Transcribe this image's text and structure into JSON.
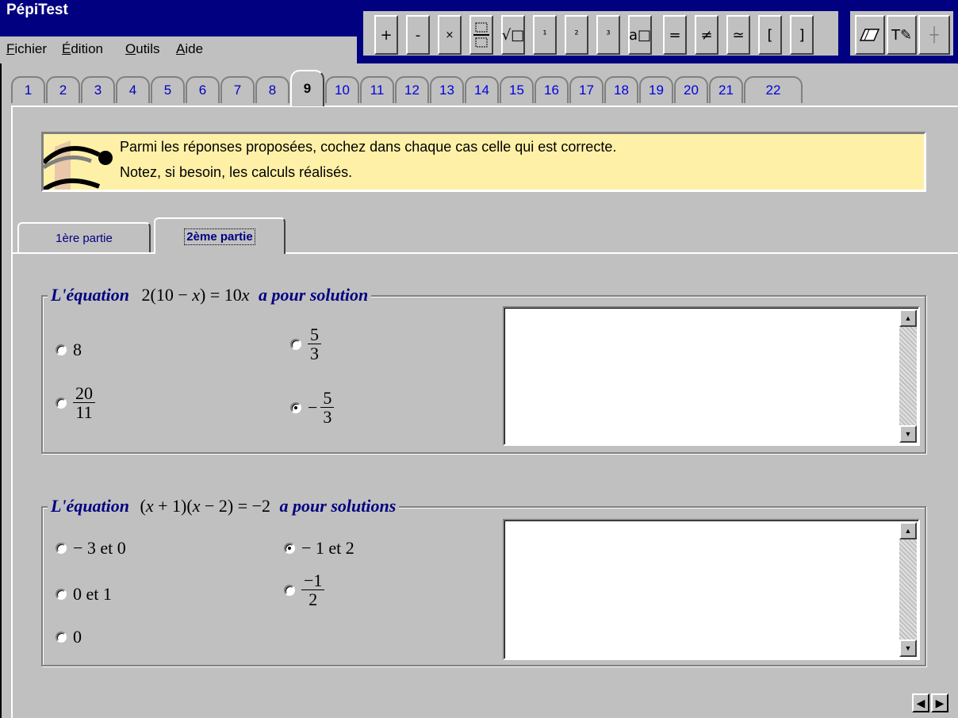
{
  "app": {
    "title": "PépiTest"
  },
  "menu": [
    {
      "label": "Fichier"
    },
    {
      "label": "Édition"
    },
    {
      "label": "Outils"
    },
    {
      "label": "Aide"
    }
  ],
  "toolbar": {
    "buttons": [
      {
        "label": "+",
        "icon": "plus-icon"
      },
      {
        "label": "-",
        "icon": "minus-icon"
      },
      {
        "label": "×",
        "icon": "multiply-icon"
      },
      {
        "label": "▭",
        "icon": "fraction-icon"
      },
      {
        "label": "√□",
        "icon": "sqrt-icon"
      },
      {
        "label": "¹",
        "icon": "superscript-1-icon"
      },
      {
        "label": "²",
        "icon": "superscript-2-icon"
      },
      {
        "label": "³",
        "icon": "superscript-3-icon"
      },
      {
        "label": "a□",
        "icon": "power-icon"
      },
      {
        "label": "=",
        "icon": "equals-icon"
      },
      {
        "label": "≠",
        "icon": "not-equal-icon"
      },
      {
        "label": "≃",
        "icon": "approx-icon"
      },
      {
        "label": "[",
        "icon": "left-bracket-icon"
      },
      {
        "label": "]",
        "icon": "right-bracket-icon"
      }
    ],
    "tools": [
      {
        "label": "⌫",
        "icon": "eraser-icon"
      },
      {
        "label": "T✎",
        "icon": "text-pen-icon"
      },
      {
        "label": "┼",
        "icon": "crosshair-icon"
      }
    ]
  },
  "page_tabs": [
    "1",
    "2",
    "3",
    "4",
    "5",
    "6",
    "7",
    "8",
    "9",
    "10",
    "11",
    "12",
    "13",
    "14",
    "15",
    "16",
    "17",
    "18",
    "19",
    "20",
    "21",
    "22"
  ],
  "active_page_tab": "9",
  "instruction": {
    "line1": "Parmi les réponses proposées, cochez dans chaque cas celle qui est correcte.",
    "line2": "Notez, si besoin, les calculs réalisés."
  },
  "sub_tabs": [
    "1ère partie",
    "2ème partie"
  ],
  "active_sub_tab": "2ème partie",
  "question1": {
    "label_pre": "L'équation",
    "equation": "2(10 − x) = 10x",
    "label_post": "a pour solution",
    "options": {
      "a": "8",
      "b_num": "5",
      "b_den": "3",
      "c_num": "20",
      "c_den": "11",
      "d_sign": "−",
      "d_num": "5",
      "d_den": "3"
    },
    "selected": "d"
  },
  "question2": {
    "label_pre": "L'équation",
    "equation": "(x + 1)(x − 2) = −2",
    "label_post": "a pour solutions",
    "options": {
      "a": "− 3 et 0",
      "b": "− 1 et 2",
      "c": "0 et 1",
      "d_num": "−1",
      "d_den": "2",
      "e": "0"
    },
    "selected": "b"
  },
  "colors": {
    "accent": "#000080",
    "instruction_bg": "#fff0a8",
    "tab_number": "#0000c0"
  }
}
